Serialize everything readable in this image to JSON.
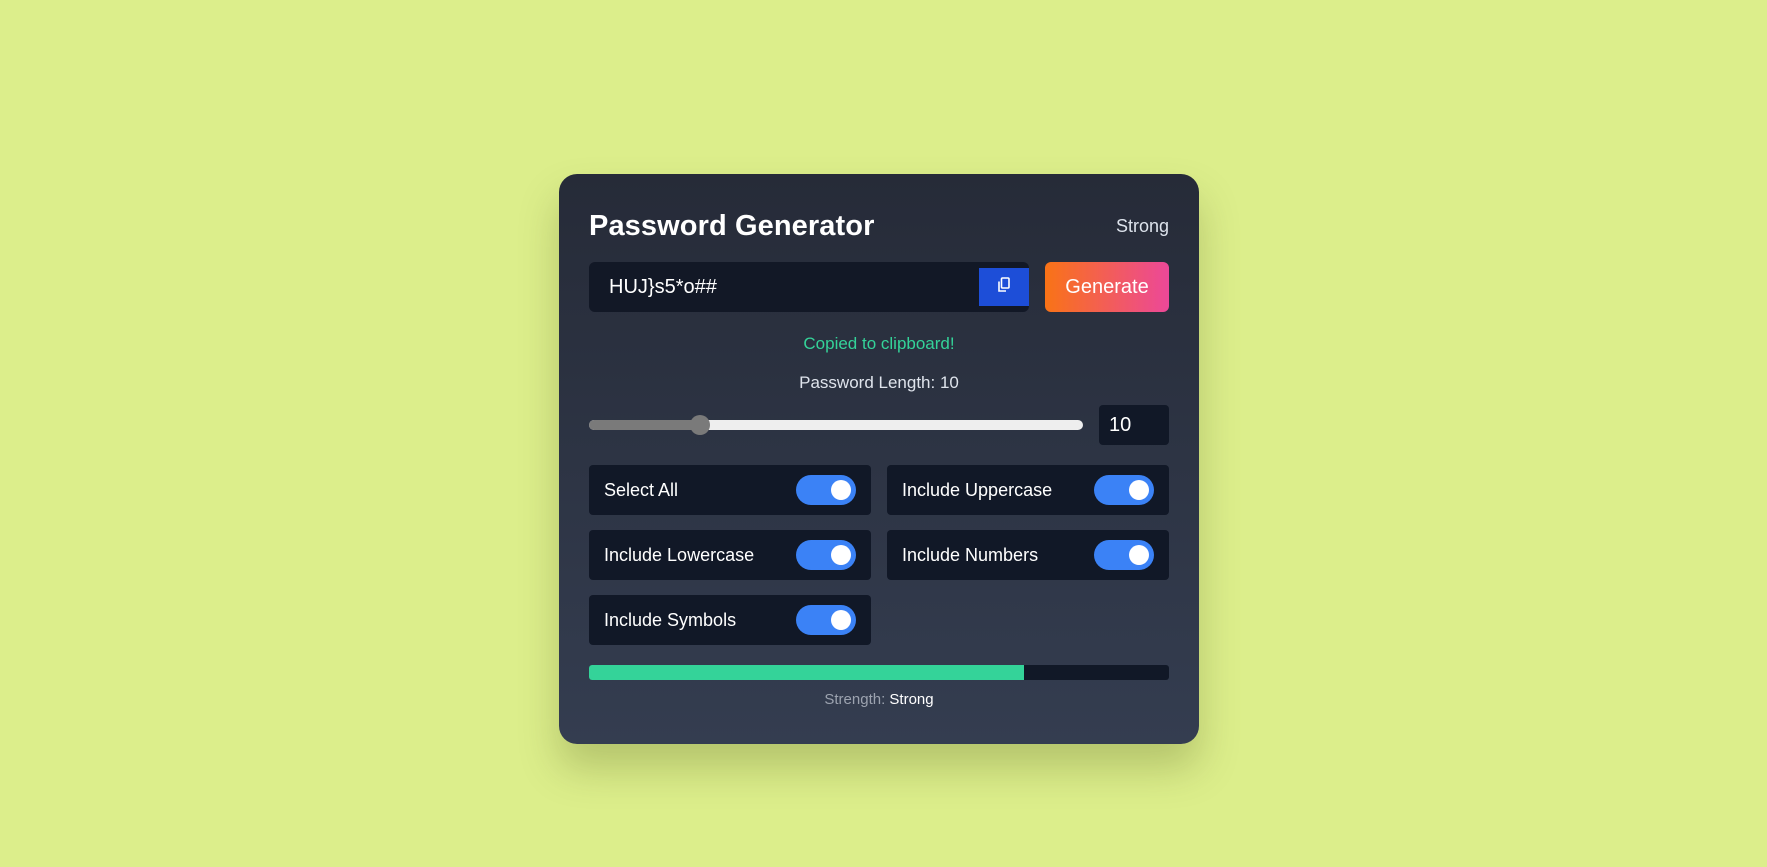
{
  "title": "Password Generator",
  "header_strength": "Strong",
  "password": "HUJ}s5*o##",
  "copy_icon": "copy-icon",
  "generate_label": "Generate",
  "copied_message": "Copied to clipboard!",
  "length_label": "Password Length: 10",
  "length": {
    "value": 10,
    "display": "10",
    "slider_fraction": 0.225
  },
  "options": [
    {
      "label": "Select All",
      "checked": true
    },
    {
      "label": "Include Uppercase",
      "checked": true
    },
    {
      "label": "Include Lowercase",
      "checked": true
    },
    {
      "label": "Include Numbers",
      "checked": true
    },
    {
      "label": "Include Symbols",
      "checked": true
    }
  ],
  "strength": {
    "label": "Strength:",
    "value": "Strong",
    "fraction": 0.75
  },
  "colors": {
    "background": "#dcee8b",
    "accent_blue": "#3b82f6",
    "copy_button": "#1d4ed8",
    "success_green": "#34d399",
    "generate_gradient": [
      "#f97316",
      "#ec4899"
    ]
  }
}
